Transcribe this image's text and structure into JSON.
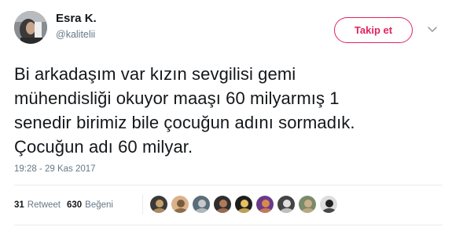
{
  "user": {
    "display_name": "Esra K.",
    "username": "@kalitelii"
  },
  "follow_button": {
    "label": "Takip et"
  },
  "tweet": {
    "lines": [
      "Bi arkadaşım var kızın sevgilisi gemi",
      "mühendisliği okuyor maaşı 60 milyarmış 1",
      "senedir birimiz bile çocuğun adını sormadık.",
      "Çocuğun adı 60 milyar."
    ],
    "timestamp": "19:28 - 29 Kas 2017"
  },
  "stats": {
    "retweets_count": "31",
    "retweets_label": "Retweet",
    "likes_count": "630",
    "likes_label": "Beğeni"
  },
  "likers": [
    {
      "color": "#3a3a3a",
      "accent": "#c8a06a"
    },
    {
      "color": "#d9b38c",
      "accent": "#7a5a3a"
    },
    {
      "color": "#5a6d7a",
      "accent": "#c9c9c9"
    },
    {
      "color": "#2e2e2e",
      "accent": "#b07a5a"
    },
    {
      "color": "#1e1e1e",
      "accent": "#e6c060"
    },
    {
      "color": "#6a3a8a",
      "accent": "#d98a4a"
    },
    {
      "color": "#444444",
      "accent": "#e0e0e0"
    },
    {
      "color": "#7a8a6a",
      "accent": "#c9b08a"
    },
    {
      "color": "#dddddd",
      "accent": "#222222"
    }
  ],
  "colors": {
    "accent": "#e0245e",
    "secondary_text": "#657786",
    "primary_text": "#14171a"
  },
  "icons": {
    "caret": "chevron-down-icon"
  }
}
